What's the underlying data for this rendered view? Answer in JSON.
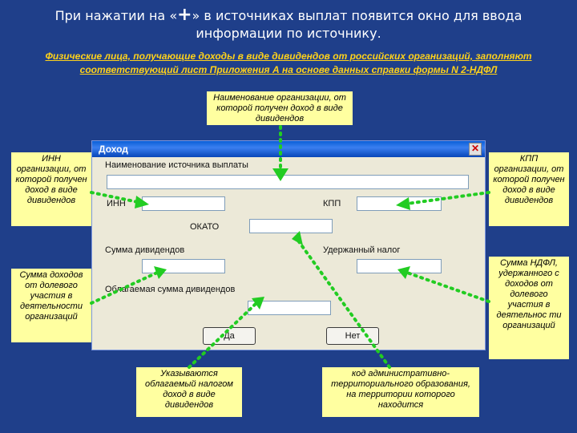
{
  "slide": {
    "title_before": "При нажатии на «",
    "title_plus": "+",
    "title_after": "» в источниках выплат появится окно для ввода информации по источнику.",
    "subtitle": "Физические лица, получающие доходы в виде дивидендов от российских организаций, заполняют соответствующий лист Приложения А на основе данных справки формы N 2-НДФЛ"
  },
  "notes": {
    "org_name": "Наименование организации, от которой получен доход в виде дивидендов",
    "inn": "ИНН организации, от которой получен доход в виде дивидендов",
    "kpp": "КПП организации, от которой получен доход в виде дивидендов",
    "income_sum": "Сумма доходов от долевого участия в деятельности организаций",
    "ndfl_withheld": "Сумма НДФЛ, удержанного с доходов от долевого участия в деятельнос ти организаций",
    "taxable_income": "Указываются облагаемый налогом доход в виде дивидендов",
    "okato_code": "код административно-территориального образования, на территории которого находится"
  },
  "dialog": {
    "title": "Доход",
    "close_glyph": "✕",
    "source_name_label": "Наименование источника выплаты",
    "source_name_value": "",
    "inn_label": "ИНН",
    "inn_value": "",
    "kpp_label": "КПП",
    "kpp_value": "",
    "okato_label": "ОКАТО",
    "okato_value": "",
    "dividend_sum_label": "Сумма дивидендов",
    "dividend_sum_value": "",
    "withheld_tax_label": "Удержанный налог",
    "withheld_tax_value": "",
    "taxable_sum_label": "Облагаемая сумма дивидендов",
    "taxable_sum_value": "",
    "yes_button": "Да",
    "no_button": "Нет"
  },
  "colors": {
    "background": "#1f3f8a",
    "note_fill": "#ffffa0",
    "arrow": "#22cc22",
    "subtitle": "#ffd21a"
  }
}
